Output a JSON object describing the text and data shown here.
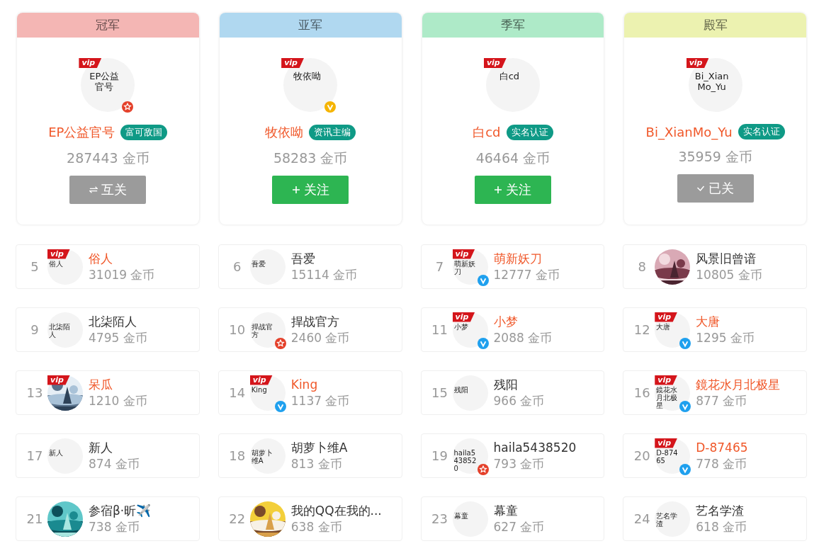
{
  "podium": [
    {
      "title": "冠军",
      "color": "#f4b6b4",
      "avatar": {
        "kind": "broken",
        "alt": "EP公益官号",
        "vip_badge": "vip",
        "badge": {
          "kind": "star"
        }
      },
      "name": "EP公益官号",
      "tag": "富可敌国",
      "coins": "287443 金币",
      "button": {
        "kind": "mutual",
        "label": "互关"
      }
    },
    {
      "title": "亚军",
      "color": "#b0d8f0",
      "avatar": {
        "kind": "broken",
        "alt": "牧依呦",
        "vip_badge": "vip",
        "badge": {
          "kind": "verified",
          "color": "#f5b400"
        }
      },
      "name": "牧依呦",
      "tag": "资讯主编",
      "coins": "58283 金币",
      "button": {
        "kind": "follow",
        "label": "关注"
      }
    },
    {
      "title": "季军",
      "color": "#aeeac8",
      "avatar": {
        "kind": "broken",
        "alt": "白cd",
        "vip_badge": "vip"
      },
      "name": "白cd",
      "tag": "实名认证",
      "coins": "46464 金币",
      "button": {
        "kind": "follow",
        "label": "关注"
      }
    },
    {
      "title": "殿军",
      "color": "#ecf2b0",
      "avatar": {
        "kind": "broken",
        "alt": "Bi_XianMo_Yu",
        "vip_badge": "vip"
      },
      "name": "Bi_XianMo_Yu",
      "tag": "实名认证",
      "coins": "35959 金币",
      "button": {
        "kind": "followed",
        "label": "已关"
      }
    }
  ],
  "ranks": [
    {
      "rank": "5",
      "avatar": {
        "kind": "broken",
        "alt": "俗人",
        "vip_badge": "vip"
      },
      "name": "俗人",
      "coins": "31019 金币"
    },
    {
      "rank": "6",
      "avatar": {
        "kind": "broken",
        "alt": "吾爱"
      },
      "name": "吾爱",
      "coins": "15114 金币"
    },
    {
      "rank": "7",
      "avatar": {
        "kind": "broken",
        "alt": "萌新妖刀",
        "vip_badge": "vip",
        "badge": {
          "kind": "verified",
          "color": "#1fa0ee"
        }
      },
      "name": "萌新妖刀",
      "coins": "12777 金币"
    },
    {
      "rank": "8",
      "name": "风景旧曾谙",
      "coins": "10805 金币"
    },
    {
      "rank": "9",
      "avatar": {
        "kind": "broken",
        "alt": "北柒陌人"
      },
      "name": "北柒陌人",
      "coins": "4795 金币"
    },
    {
      "rank": "10",
      "avatar": {
        "kind": "broken",
        "alt": "捍战官方",
        "badge": {
          "kind": "star"
        }
      },
      "name": "捍战官方",
      "coins": "2460 金币"
    },
    {
      "rank": "11",
      "avatar": {
        "kind": "broken",
        "alt": "小梦",
        "vip_badge": "vip",
        "badge": {
          "kind": "verified",
          "color": "#1fa0ee"
        }
      },
      "name": "小梦",
      "coins": "2088 金币"
    },
    {
      "rank": "12",
      "avatar": {
        "kind": "broken",
        "alt": "大唐",
        "vip_badge": "vip",
        "badge": {
          "kind": "verified",
          "color": "#1fa0ee"
        }
      },
      "name": "大唐",
      "coins": "1295 金币"
    },
    {
      "rank": "13",
      "avatar": {
        "kind": "picture",
        "vip_badge": "vip"
      },
      "name": "呆瓜",
      "coins": "1210 金币"
    },
    {
      "rank": "14",
      "avatar": {
        "kind": "broken",
        "alt": "King",
        "vip_badge": "vip",
        "badge": {
          "kind": "verified",
          "color": "#1fa0ee"
        }
      },
      "name": "King",
      "coins": "1137 金币"
    },
    {
      "rank": "15",
      "avatar": {
        "kind": "broken",
        "alt": "残阳"
      },
      "name": "残阳",
      "coins": "966 金币"
    },
    {
      "rank": "16",
      "avatar": {
        "kind": "broken",
        "alt": "鏡花水月北极星",
        "vip_badge": "vip",
        "badge": {
          "kind": "verified",
          "color": "#1fa0ee"
        }
      },
      "name": "鏡花水月北极星",
      "coins": "877 金币"
    },
    {
      "rank": "17",
      "avatar": {
        "kind": "broken",
        "alt": "新人"
      },
      "name": "新人",
      "coins": "874 金币"
    },
    {
      "rank": "18",
      "avatar": {
        "kind": "broken",
        "alt": "胡萝卜维A"
      },
      "name": "胡萝卜维A",
      "coins": "813 金币"
    },
    {
      "rank": "19",
      "avatar": {
        "kind": "broken",
        "alt": "haila5438520",
        "badge": {
          "kind": "star"
        }
      },
      "name": "haila5438520",
      "coins": "793 金币"
    },
    {
      "rank": "20",
      "avatar": {
        "kind": "broken",
        "alt": "D-87465",
        "vip_badge": "vip",
        "badge": {
          "kind": "verified",
          "color": "#1fa0ee"
        }
      },
      "name": "D-87465",
      "coins": "778 金币"
    },
    {
      "rank": "21",
      "name": "参宿β·昕✈️",
      "coins": "738 金币"
    },
    {
      "rank": "22",
      "name": "我的QQ在我的...",
      "coins": "638 金币"
    },
    {
      "rank": "23",
      "avatar": {
        "kind": "broken",
        "alt": "幕童"
      },
      "name": "幕童",
      "coins": "627 金币"
    },
    {
      "rank": "24",
      "avatar": {
        "kind": "broken",
        "alt": "艺名学渣"
      },
      "name": "艺名学渣",
      "coins": "618 金币"
    }
  ]
}
